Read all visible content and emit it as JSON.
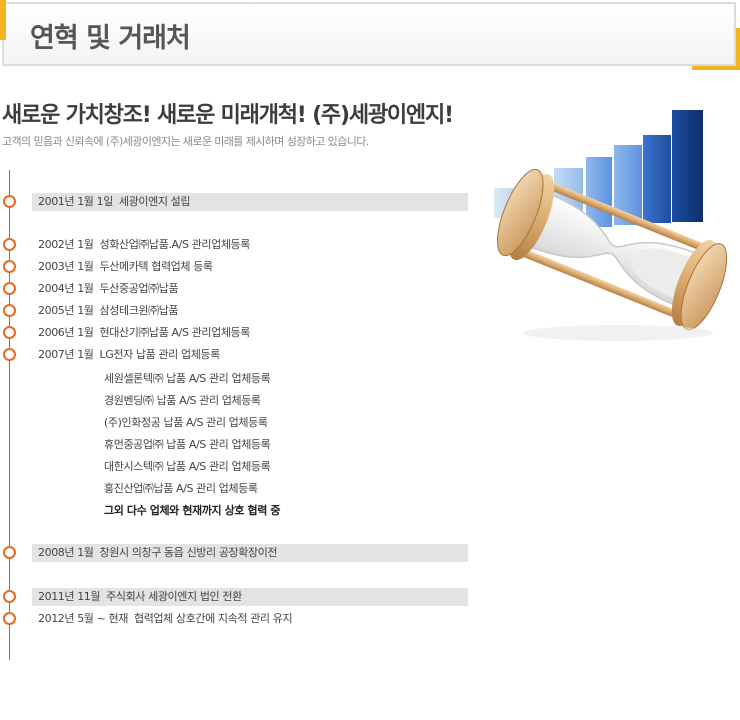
{
  "header": {
    "title": "연혁 및 거래처"
  },
  "intro": {
    "title": "새로운 가치창조! 새로운 미래개척! (주)세광이엔지!",
    "subtitle": "고객의 믿음과 신뢰속에 (주)세광이엔지는 새로운 미래를 제시하며 성장하고 있습니다."
  },
  "timeline": [
    {
      "date": "2001년 1월 1일",
      "text": "세광이엔지 설립"
    },
    {
      "date": "2002년 1월",
      "text": "성화산업㈜납품.A/S 관리업체등록"
    },
    {
      "date": "2003년 1월",
      "text": "두산메카텍 협력업체 등록"
    },
    {
      "date": "2004년 1월",
      "text": "두산중공업㈜납품"
    },
    {
      "date": "2005년 1월",
      "text": "삼성테크윈㈜납품"
    },
    {
      "date": "2006년 1월",
      "text": "현대산기㈜납품 A/S 관리업체등록"
    },
    {
      "date": "2007년 1월",
      "text": "LG전자 납품 관리 업체등록"
    },
    {
      "date": "2008년 1월",
      "text": "창원시 의창구 동읍 신방리 공장확장이전"
    },
    {
      "date": "2011년 11월",
      "text": "주식회사 세광이엔지 법인 전환"
    },
    {
      "date": "2012년 5월 ~ 현재",
      "text": "협력업체 상호간에 지속적 관리 유지"
    }
  ],
  "partners_2007": [
    "세원셀론텍㈜ 납품 A/S 관리 업체등록",
    "경원벤딩㈜ 납품 A/S 관리 업체등록",
    "(주)인화정공 납품 A/S 관리 업체등록",
    "휴먼중공업㈜ 납품 A/S 관리 업체등록",
    "대한시스텍㈜ 납품 A/S 관리 업체등록",
    "홍진산업㈜납품 A/S 관리 업체등록",
    "그외 다수 업체와 현재까지 상호 협력 중"
  ],
  "colors": {
    "accent": "#f2b51b",
    "dot": "#e46b1f",
    "band": "#e3e3e3"
  },
  "icons": {
    "illustration": "hourglass-bar-chart-illustration",
    "timeline_dot": "circle-marker-icon"
  }
}
